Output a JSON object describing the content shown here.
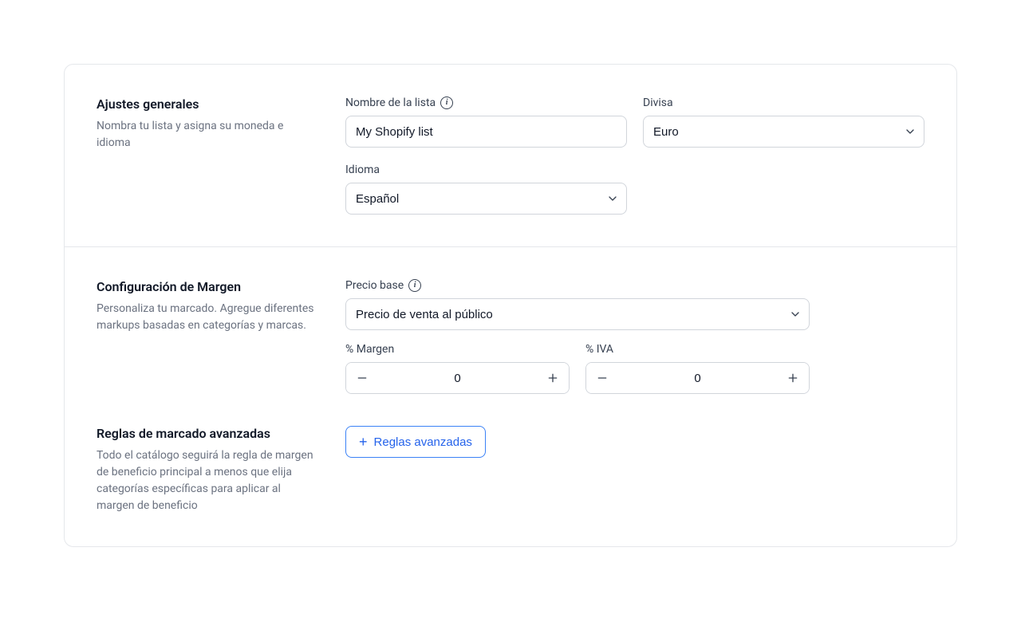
{
  "general": {
    "title": "Ajustes generales",
    "desc": "Nombra tu lista y asigna su moneda e idioma",
    "list_name_label": "Nombre de la lista",
    "list_name_value": "My Shopify list",
    "currency_label": "Divisa",
    "currency_value": "Euro",
    "language_label": "Idioma",
    "language_value": "Español"
  },
  "margin": {
    "title": "Configuración de Margen",
    "desc": "Personaliza tu marcado. Agregue diferentes markups basadas en categorías y marcas.",
    "base_price_label": "Precio base",
    "base_price_value": "Precio de venta al público",
    "margin_label": "% Margen",
    "margin_value": "0",
    "vat_label": "% IVA",
    "vat_value": "0"
  },
  "advanced": {
    "title": "Reglas de marcado avanzadas",
    "desc": "Todo el catálogo seguirá la regla de margen de beneficio principal a menos que elija categorías específicas para aplicar al margen de beneficio",
    "button_label": "Reglas avanzadas"
  }
}
